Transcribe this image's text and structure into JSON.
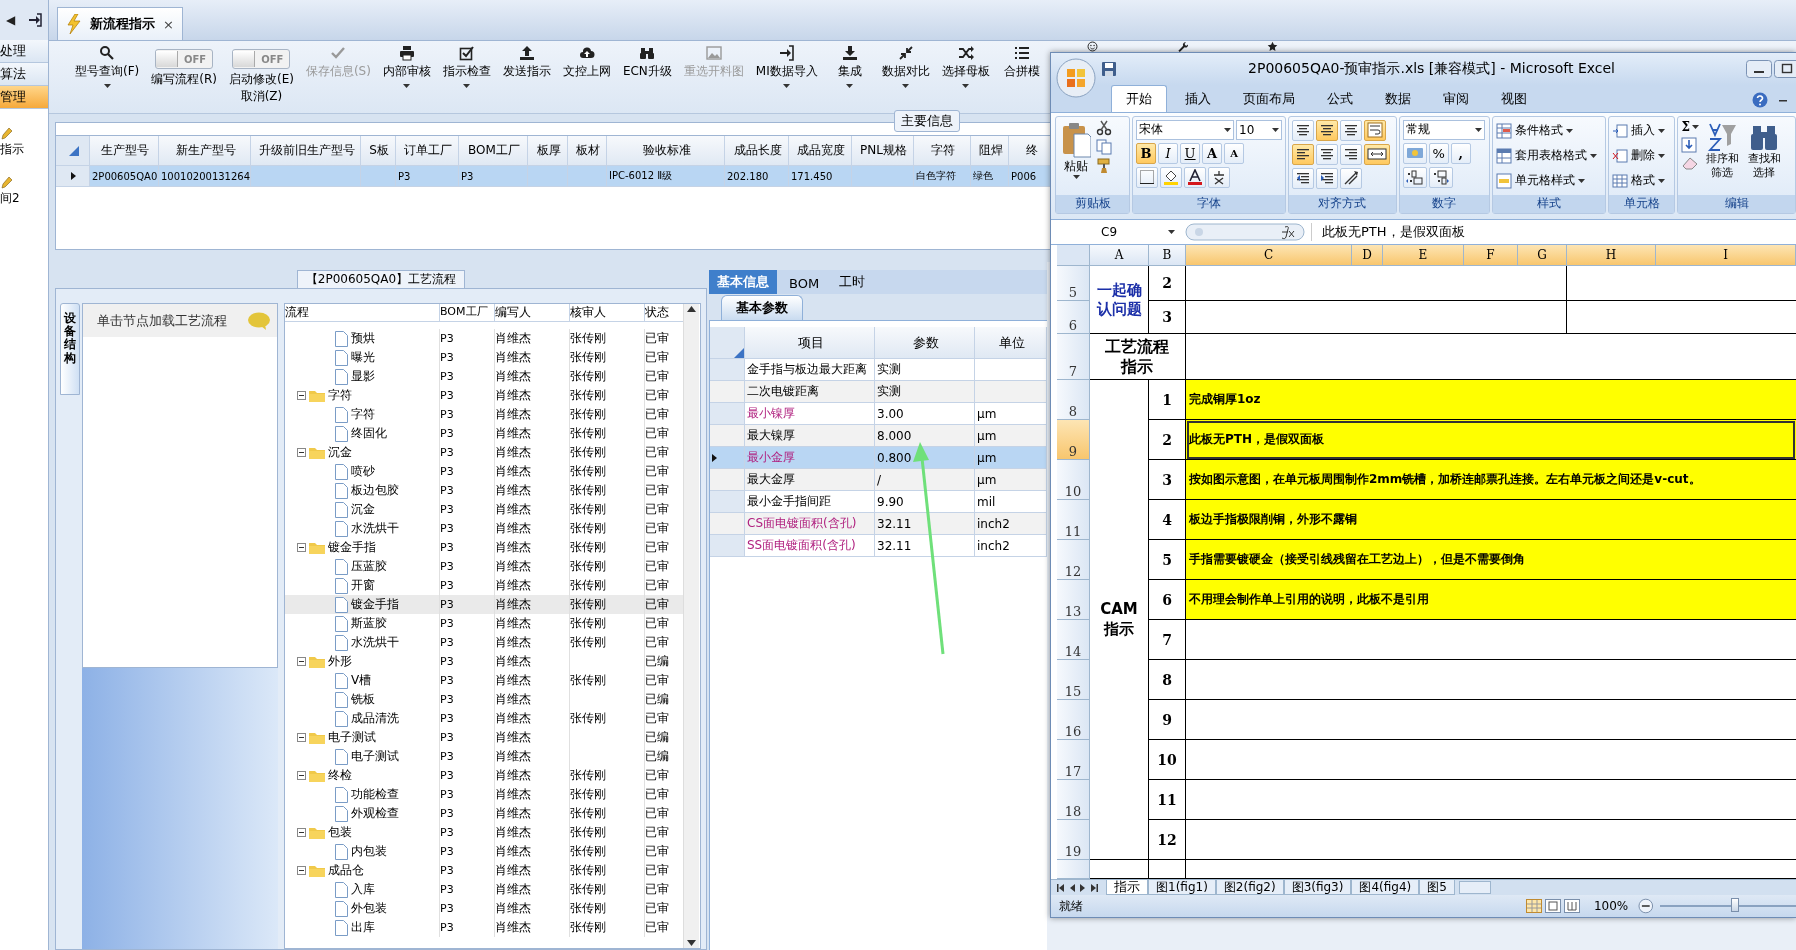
{
  "nav": {
    "back": "◀"
  },
  "side_items": [
    {
      "label": "处理",
      "kind": "tab",
      "selected": false
    },
    {
      "label": "算法",
      "kind": "tab",
      "selected": false
    },
    {
      "label": "管理",
      "kind": "tab",
      "selected": true
    },
    {
      "label": "指示",
      "kind": "link",
      "selected": false
    },
    {
      "label": "间2",
      "kind": "link",
      "selected": false
    }
  ],
  "doc_tab": {
    "label": "新流程指示",
    "close": "×"
  },
  "toolbar": [
    {
      "kind": "button",
      "label": "型号查询(F)",
      "dropdown": true,
      "disabled": false
    },
    {
      "kind": "switch",
      "label": "编写流程(R)",
      "switch_text": "OFF",
      "on": false
    },
    {
      "kind": "switch",
      "label": "启动修改(E)",
      "sublabel": "取消(Z)",
      "switch_text": "OFF",
      "on": false
    },
    {
      "kind": "button",
      "label": "保存信息(S)",
      "dropdown": false,
      "disabled": true
    },
    {
      "kind": "button",
      "label": "内部审核",
      "dropdown": true,
      "disabled": false
    },
    {
      "kind": "button",
      "label": "指示检查",
      "dropdown": true,
      "disabled": false
    },
    {
      "kind": "button",
      "label": "发送指示",
      "dropdown": false,
      "disabled": false
    },
    {
      "kind": "button",
      "label": "文控上网",
      "dropdown": false,
      "disabled": false
    },
    {
      "kind": "button",
      "label": "ECN升级",
      "dropdown": false,
      "disabled": false
    },
    {
      "kind": "button",
      "label": "重选开料图",
      "dropdown": false,
      "disabled": true
    },
    {
      "kind": "button",
      "label": "MI数据导入",
      "dropdown": true,
      "disabled": false
    },
    {
      "kind": "button",
      "label": "集成",
      "dropdown": true,
      "disabled": false
    },
    {
      "kind": "button",
      "label": "数据对比",
      "dropdown": true,
      "disabled": false
    },
    {
      "kind": "button",
      "label": "选择母板",
      "dropdown": true,
      "disabled": false
    },
    {
      "kind": "button",
      "label": "合拼模",
      "dropdown": false,
      "disabled": false
    },
    {
      "kind": "icon"
    },
    {
      "kind": "icon"
    },
    {
      "kind": "icon"
    }
  ],
  "main_info": {
    "legend": "主要信息",
    "columns": [
      "生产型号",
      "新生产型号",
      "升级前旧生产型号",
      "S板",
      "订单工厂",
      "BOM工厂",
      "板厚",
      "板材",
      "验收标准",
      "成品长度",
      "成品宽度",
      "PNL规格",
      "字符",
      "阻焊",
      "终"
    ],
    "rows": [
      {
        "selected": true,
        "cells": [
          "2P00605QA0",
          "10010200131264",
          null,
          null,
          "P3",
          "P3",
          null,
          null,
          "IPC-6012 Ⅱ级",
          "202.180",
          "171.450",
          null,
          "白色字符",
          "绿色",
          "P006"
        ]
      }
    ]
  },
  "process": {
    "title": "【2P00605QA0】工艺流程",
    "side_tab": "设备结构",
    "node_hint": "单击节点加载工艺流程",
    "columns": [
      "流程",
      "BOM工厂",
      "编写人",
      "核审人",
      "状态"
    ],
    "tree": [
      {
        "children": [
          {
            "label": "预烘",
            "bom": "P3",
            "writer": "肖维杰",
            "reviewer": "张传刚",
            "status": "已审",
            "selected": false
          },
          {
            "label": "曝光",
            "bom": "P3",
            "writer": "肖维杰",
            "reviewer": "张传刚",
            "status": "已审",
            "selected": false
          },
          {
            "label": "显影",
            "bom": "P3",
            "writer": "肖维杰",
            "reviewer": "张传刚",
            "status": "已审",
            "selected": false
          }
        ]
      },
      {
        "label": "字符",
        "bom": "P3",
        "writer": "肖维杰",
        "reviewer": "张传刚",
        "status": "已审",
        "selected": false,
        "expanded": true,
        "children": [
          {
            "label": "字符",
            "bom": "P3",
            "writer": "肖维杰",
            "reviewer": "张传刚",
            "status": "已审",
            "selected": false
          },
          {
            "label": "终固化",
            "bom": "P3",
            "writer": "肖维杰",
            "reviewer": "张传刚",
            "status": "已审",
            "selected": false
          }
        ]
      },
      {
        "label": "沉金",
        "bom": "P3",
        "writer": "肖维杰",
        "reviewer": "张传刚",
        "status": "已审",
        "selected": false,
        "expanded": true,
        "children": [
          {
            "label": "喷砂",
            "bom": "P3",
            "writer": "肖维杰",
            "reviewer": "张传刚",
            "status": "已审",
            "selected": false
          },
          {
            "label": "板边包胶",
            "bom": "P3",
            "writer": "肖维杰",
            "reviewer": "张传刚",
            "status": "已审",
            "selected": false
          },
          {
            "label": "沉金",
            "bom": "P3",
            "writer": "肖维杰",
            "reviewer": "张传刚",
            "status": "已审",
            "selected": false
          },
          {
            "label": "水洗烘干",
            "bom": "P3",
            "writer": "肖维杰",
            "reviewer": "张传刚",
            "status": "已审",
            "selected": false
          }
        ]
      },
      {
        "label": "镀金手指",
        "bom": "P3",
        "writer": "肖维杰",
        "reviewer": "张传刚",
        "status": "已审",
        "selected": false,
        "expanded": true,
        "children": [
          {
            "label": "压蓝胶",
            "bom": "P3",
            "writer": "肖维杰",
            "reviewer": "张传刚",
            "status": "已审",
            "selected": false
          },
          {
            "label": "开窗",
            "bom": "P3",
            "writer": "肖维杰",
            "reviewer": "张传刚",
            "status": "已审",
            "selected": false
          },
          {
            "label": "镀金手指",
            "bom": "P3",
            "writer": "肖维杰",
            "reviewer": "张传刚",
            "status": "已审",
            "selected": true
          },
          {
            "label": "斯蓝胶",
            "bom": "P3",
            "writer": "肖维杰",
            "reviewer": "张传刚",
            "status": "已审",
            "selected": false
          },
          {
            "label": "水洗烘干",
            "bom": "P3",
            "writer": "肖维杰",
            "reviewer": "张传刚",
            "status": "已审",
            "selected": false
          }
        ]
      },
      {
        "label": "外形",
        "bom": "P3",
        "writer": "肖维杰",
        "status": "已编",
        "selected": false,
        "expanded": true,
        "children": [
          {
            "label": "V槽",
            "bom": "P3",
            "writer": "肖维杰",
            "reviewer": "张传刚",
            "status": "已审",
            "selected": false
          },
          {
            "label": "铣板",
            "bom": "P3",
            "writer": "肖维杰",
            "status": "已编",
            "selected": false
          },
          {
            "label": "成品清洗",
            "bom": "P3",
            "writer": "肖维杰",
            "reviewer": "张传刚",
            "status": "已审",
            "selected": false
          }
        ]
      },
      {
        "label": "电子测试",
        "bom": "P3",
        "writer": "肖维杰",
        "status": "已编",
        "selected": false,
        "expanded": true,
        "children": [
          {
            "label": "电子测试",
            "bom": "P3",
            "writer": "肖维杰",
            "status": "已编",
            "selected": false
          }
        ]
      },
      {
        "label": "终检",
        "bom": "P3",
        "writer": "肖维杰",
        "reviewer": "张传刚",
        "status": "已审",
        "selected": false,
        "expanded": true,
        "children": [
          {
            "label": "功能检查",
            "bom": "P3",
            "writer": "肖维杰",
            "reviewer": "张传刚",
            "status": "已审",
            "selected": false
          },
          {
            "label": "外观检查",
            "bom": "P3",
            "writer": "肖维杰",
            "reviewer": "张传刚",
            "status": "已审",
            "selected": false
          }
        ]
      },
      {
        "label": "包装",
        "bom": "P3",
        "writer": "肖维杰",
        "reviewer": "张传刚",
        "status": "已审",
        "selected": false,
        "expanded": true,
        "children": [
          {
            "label": "内包装",
            "bom": "P3",
            "writer": "肖维杰",
            "reviewer": "张传刚",
            "status": "已审",
            "selected": false
          }
        ]
      },
      {
        "label": "成品仓",
        "bom": "P3",
        "writer": "肖维杰",
        "reviewer": "张传刚",
        "status": "已审",
        "selected": false,
        "expanded": true,
        "children": [
          {
            "label": "入库",
            "bom": "P3",
            "writer": "肖维杰",
            "reviewer": "张传刚",
            "status": "已审",
            "selected": false
          },
          {
            "label": "外包装",
            "bom": "P3",
            "writer": "肖维杰",
            "reviewer": "张传刚",
            "status": "已审",
            "selected": false
          },
          {
            "label": "出库",
            "bom": "P3",
            "writer": "肖维杰",
            "reviewer": "张传刚",
            "status": "已审",
            "selected": false
          }
        ]
      }
    ]
  },
  "params": {
    "tabs": [
      {
        "label": "基本信息",
        "selected": true
      },
      {
        "label": "BOM",
        "selected": false
      },
      {
        "label": "工时",
        "selected": false
      }
    ],
    "subtab": "基本参数",
    "columns": [
      "项目",
      "参数",
      "单位"
    ],
    "rows": [
      {
        "item": "金手指与板边最大距离",
        "value": "实测",
        "required": false,
        "selected": false
      },
      {
        "item": "二次电镀距离",
        "value": "实测",
        "required": false,
        "selected": false
      },
      {
        "item": "最小镍厚",
        "value": "3.00",
        "unit": "μm",
        "required": true,
        "selected": false
      },
      {
        "item": "最大镍厚",
        "value": "8.000",
        "unit": "μm",
        "required": false,
        "selected": false
      },
      {
        "item": "最小金厚",
        "value": "0.800",
        "unit": "μm",
        "required": true,
        "selected": true
      },
      {
        "item": "最大金厚",
        "value": "/",
        "unit": "μm",
        "required": false,
        "selected": false
      },
      {
        "item": "最小金手指间距",
        "value": "9.90",
        "unit": "mil",
        "required": false,
        "selected": false
      },
      {
        "item": "CS面电镀面积(含孔)",
        "value": "32.11",
        "unit": "inch2",
        "required": true,
        "selected": false
      },
      {
        "item": "SS面电镀面积(含孔)",
        "value": "32.11",
        "unit": "inch2",
        "required": true,
        "selected": false
      }
    ]
  },
  "excel": {
    "title": "2P00605QA0-预审指示.xls  [兼容模式]  -  Microsoft Excel",
    "tabs": [
      {
        "label": "开始",
        "selected": true
      },
      {
        "label": "插入",
        "selected": false
      },
      {
        "label": "页面布局",
        "selected": false
      },
      {
        "label": "公式",
        "selected": false
      },
      {
        "label": "数据",
        "selected": false
      },
      {
        "label": "审阅",
        "selected": false
      },
      {
        "label": "视图",
        "selected": false
      }
    ],
    "ribbon": {
      "groups": [
        "剪贴板",
        "字体",
        "对齐方式",
        "数字",
        "样式",
        "单元格",
        "编辑"
      ],
      "paste": "粘贴",
      "font_box": "宋体",
      "size_box": "10",
      "bold": "B",
      "italic": "I",
      "underline": "U",
      "grow": "A",
      "shrink": "A",
      "number_format": "常规",
      "percent": "%",
      "comma": ",",
      "styles": [
        "条件格式",
        "套用表格格式",
        "单元格样式"
      ],
      "cells": [
        "插入",
        "删除",
        "格式"
      ],
      "sum": "Σ",
      "sort": "排序和筛选",
      "find": "查找和选择"
    },
    "name_box": "C9",
    "formula": "此板无PTH，是假双面板",
    "columns": [
      {
        "label": "A",
        "selected": false
      },
      {
        "label": "B",
        "selected": false
      },
      {
        "label": "C",
        "selected": true
      },
      {
        "label": "D",
        "selected": true
      },
      {
        "label": "E",
        "selected": true
      },
      {
        "label": "F",
        "selected": true
      },
      {
        "label": "G",
        "selected": true
      },
      {
        "label": "H",
        "selected": true
      },
      {
        "label": "I",
        "selected": true
      }
    ],
    "rows": [
      {
        "number": "5",
        "selected": false
      },
      {
        "number": "6",
        "selected": false
      },
      {
        "number": "7",
        "selected": false
      },
      {
        "number": "8",
        "selected": false
      },
      {
        "number": "9",
        "selected": true
      },
      {
        "number": "10",
        "selected": false
      },
      {
        "number": "11",
        "selected": false
      },
      {
        "number": "12",
        "selected": false
      },
      {
        "number": "13",
        "selected": false
      },
      {
        "number": "14",
        "selected": false
      },
      {
        "number": "15",
        "selected": false
      },
      {
        "number": "16",
        "selected": false
      },
      {
        "number": "17",
        "selected": false
      },
      {
        "number": "18",
        "selected": false
      },
      {
        "number": "19",
        "selected": false
      }
    ],
    "confirm": {
      "label": "一起确认问题",
      "items": [
        "2",
        "3"
      ]
    },
    "process_label": "工艺流程指示",
    "cam": {
      "label": "CAM指示",
      "items": [
        {
          "no": "1",
          "text": "完成铜厚1oz",
          "highlighted": true,
          "selected": false
        },
        {
          "no": "2",
          "text": "此板无PTH，是假双面板",
          "highlighted": true,
          "selected": true
        },
        {
          "no": "3",
          "text": "按如图示意图，在单元板周围制作2mm铣槽，加桥连邮票孔连接。左右单元板之间还是v-cut。",
          "highlighted": true,
          "selected": false
        },
        {
          "no": "4",
          "text": "板边手指极限削铜，外形不露铜",
          "highlighted": true,
          "selected": false
        },
        {
          "no": "5",
          "text": "手指需要镀硬金（接受引线残留在工艺边上），但是不需要倒角",
          "highlighted": true,
          "selected": false
        },
        {
          "no": "6",
          "text": "不用理会制作单上引用的说明，此板不是引用",
          "highlighted": true,
          "selected": false
        },
        {
          "no": "7",
          "highlighted": false,
          "selected": false
        },
        {
          "no": "8",
          "highlighted": false,
          "selected": false
        },
        {
          "no": "9",
          "highlighted": false,
          "selected": false
        },
        {
          "no": "10",
          "highlighted": false,
          "selected": false
        },
        {
          "no": "11",
          "highlighted": false,
          "selected": false
        },
        {
          "no": "12",
          "highlighted": false,
          "selected": false
        }
      ]
    },
    "sheets": [
      {
        "label": "指示",
        "selected": true
      },
      {
        "label": "图1(fig1)",
        "selected": false
      },
      {
        "label": "图2(fig2)",
        "selected": false
      },
      {
        "label": "图3(fig3)",
        "selected": false
      },
      {
        "label": "图4(fig4)",
        "selected": false
      },
      {
        "label": "图5",
        "selected": false
      }
    ],
    "status": "就绪",
    "zoom": "100%",
    "zoom_slider": {
      "level": 0.55
    }
  }
}
